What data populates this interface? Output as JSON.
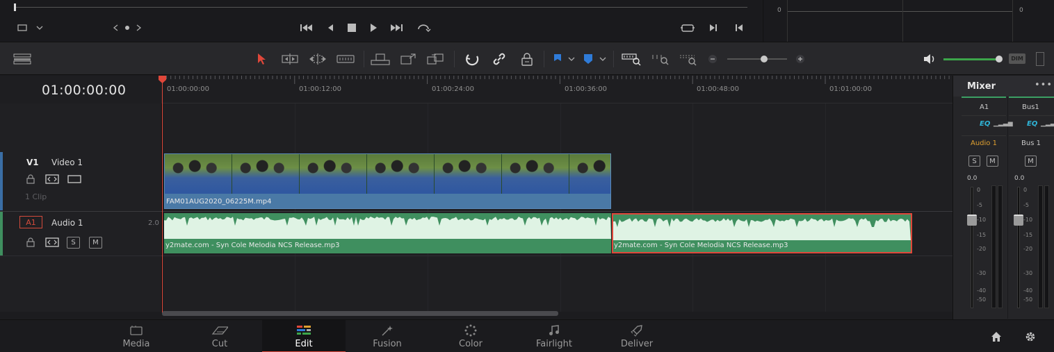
{
  "viewer": {
    "transport_icons": [
      "jump-to-start-icon",
      "step-back-icon",
      "stop-icon",
      "play-icon",
      "jump-to-end-icon",
      "loop-icon"
    ],
    "scope_values": [
      "0",
      "0"
    ]
  },
  "toolbar": {
    "colors": {
      "accent_red": "#e0473a",
      "flag_blue": "#2f7bd8",
      "volume_green": "#3ca64a"
    },
    "dim_label": "DIM"
  },
  "timeline": {
    "timecode": "01:00:00:00",
    "ruler_labels": [
      "01:00:00:00",
      "01:00:12:00",
      "01:00:24:00",
      "01:00:36:00",
      "01:00:48:00",
      "01:01:00:00"
    ]
  },
  "tracks": {
    "video": {
      "id": "V1",
      "name": "Video 1",
      "clip_count": "1 Clip"
    },
    "audio": {
      "id": "A1",
      "name": "Audio 1",
      "channels": "2.0",
      "solo": "S",
      "mute": "M"
    }
  },
  "clips": {
    "video_clip": "FAM01AUG2020_06225M.mp4",
    "audio_clip_1": "y2mate.com - Syn Cole  Melodia NCS Release.mp3",
    "audio_clip_2": "y2mate.com - Syn Cole  Melodia NCS Release.mp3"
  },
  "mixer": {
    "title": "Mixer",
    "channels": [
      {
        "id": "A1",
        "eq": "EQ",
        "name": "Audio 1",
        "mute": "M",
        "solo": "S",
        "level": "0.0"
      },
      {
        "id": "Bus1",
        "eq": "EQ",
        "name": "Bus 1",
        "mute": "M",
        "level": "0.0"
      }
    ],
    "scale": [
      "0",
      "-5",
      "-10",
      "-15",
      "-20",
      "-30",
      "-40",
      "-50"
    ]
  },
  "pages": [
    {
      "label": "Media",
      "icon": "media-icon"
    },
    {
      "label": "Cut",
      "icon": "cut-icon"
    },
    {
      "label": "Edit",
      "icon": "edit-icon",
      "active": true
    },
    {
      "label": "Fusion",
      "icon": "fusion-icon"
    },
    {
      "label": "Color",
      "icon": "color-icon"
    },
    {
      "label": "Fairlight",
      "icon": "fairlight-icon"
    },
    {
      "label": "Deliver",
      "icon": "deliver-icon"
    }
  ]
}
